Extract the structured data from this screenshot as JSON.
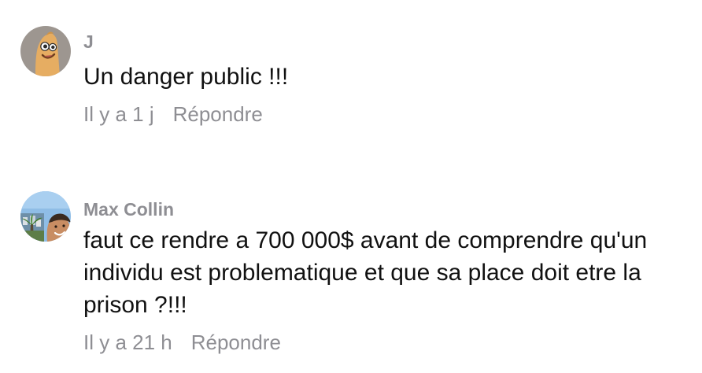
{
  "comments": [
    {
      "author": "J",
      "text": "Un danger public !!!",
      "time": "Il y a 1 j",
      "reply_label": "Répondre",
      "avatar_icon": "cartoon-character-avatar"
    },
    {
      "author": "Max Collin",
      "text": "faut ce rendre a 700 000$ avant de comprendre qu'un individu est problematique et que sa place doit etre la prison ?!!!",
      "time": "Il y a 21 h",
      "reply_label": "Répondre",
      "avatar_icon": "photo-avatar"
    }
  ],
  "colors": {
    "meta_text": "#8e8e93",
    "body_text": "#111111",
    "background": "#ffffff"
  }
}
